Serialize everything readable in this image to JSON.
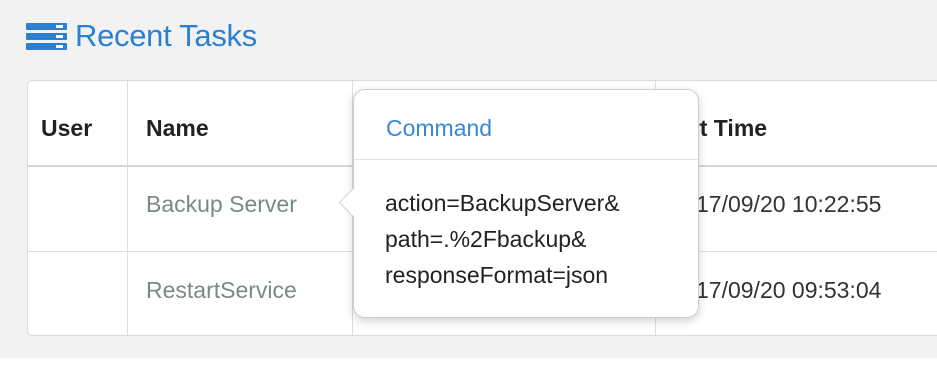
{
  "panel": {
    "title": "Recent Tasks",
    "title_icon": "server-icon",
    "accent_color": "#2d7fd0"
  },
  "table": {
    "columns": [
      "User",
      "Name",
      "",
      "Start Time"
    ],
    "start_time_header_visible": "art Time",
    "rows": [
      {
        "user": "",
        "name": "Backup Server",
        "start_time_visible": "17/09/20 10:22:55"
      },
      {
        "user": "",
        "name": "RestartService",
        "start_time_visible": "17/09/20 09:53:04"
      }
    ]
  },
  "popover": {
    "title": "Command",
    "lines": [
      "action=BackupServer&",
      "path=.%2Fbackup&",
      "responseFormat=json"
    ]
  }
}
